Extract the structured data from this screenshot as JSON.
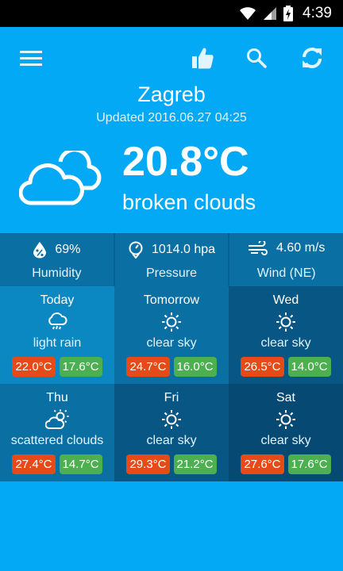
{
  "status_bar": {
    "time": "4:39"
  },
  "current": {
    "city": "Zagreb",
    "updated": "Updated 2016.06.27 04:25",
    "temperature": "20.8°C",
    "description": "broken clouds",
    "icon": "cloud-icon"
  },
  "stats": [
    {
      "value": "69%",
      "label": "Humidity",
      "icon": "humidity-icon"
    },
    {
      "value": "1014.0 hpa",
      "label": "Pressure",
      "icon": "pressure-gauge-icon"
    },
    {
      "value": "4.60 m/s",
      "label": "Wind (NE)",
      "icon": "wind-icon"
    }
  ],
  "forecast": [
    {
      "day": "Today",
      "condition": "light rain",
      "high": "22.0°C",
      "low": "17.6°C",
      "icon": "rain-cloud-icon"
    },
    {
      "day": "Tomorrow",
      "condition": "clear sky",
      "high": "24.7°C",
      "low": "16.0°C",
      "icon": "sun-icon"
    },
    {
      "day": "Wed",
      "condition": "clear sky",
      "high": "26.5°C",
      "low": "14.0°C",
      "icon": "sun-icon"
    },
    {
      "day": "Thu",
      "condition": "scattered clouds",
      "high": "27.4°C",
      "low": "14.7°C",
      "icon": "partly-cloudy-icon"
    },
    {
      "day": "Fri",
      "condition": "clear sky",
      "high": "29.3°C",
      "low": "21.2°C",
      "icon": "sun-icon"
    },
    {
      "day": "Sat",
      "condition": "clear sky",
      "high": "27.6°C",
      "low": "17.6°C",
      "icon": "sun-icon"
    }
  ],
  "colors": {
    "background": "#03A9F4",
    "high_chip": "#E64A19",
    "low_chip": "#4CAF50"
  }
}
